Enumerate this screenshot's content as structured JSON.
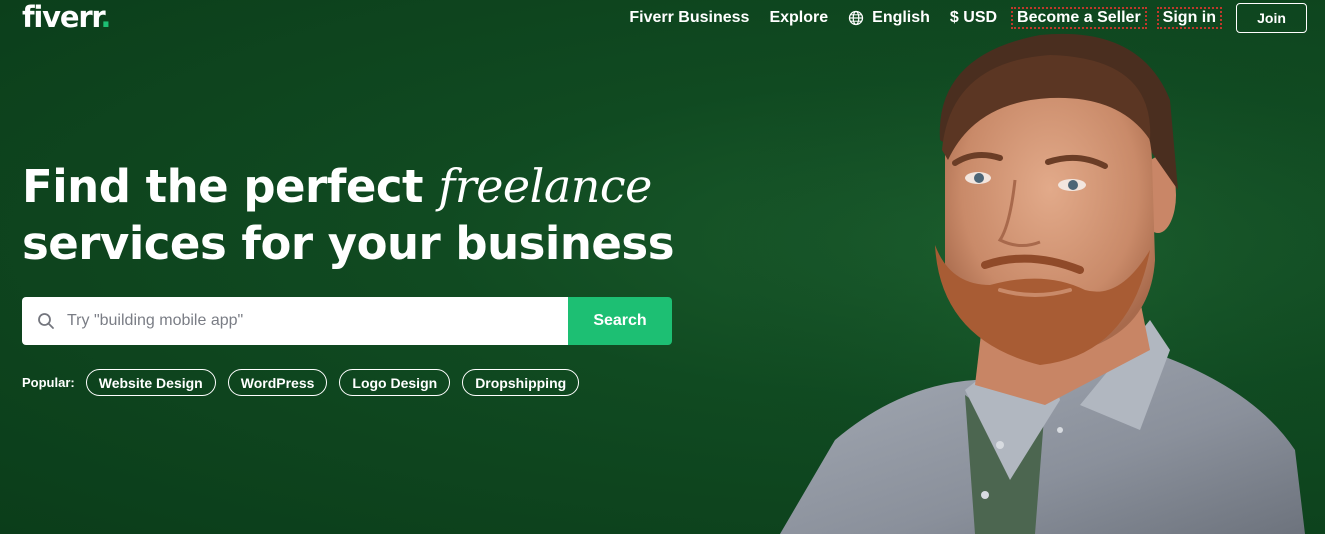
{
  "header": {
    "logo_text": "fiverr",
    "logo_dot": ".",
    "nav": {
      "business": "Fiverr Business",
      "explore": "Explore",
      "language": "English",
      "currency": "$ USD",
      "become_seller": "Become a Seller",
      "sign_in": "Sign in",
      "join": "Join"
    },
    "icons": {
      "language": "globe-icon"
    }
  },
  "hero": {
    "headline_part1": "Find the perfect ",
    "headline_accent": "freelance",
    "headline_part2": "services for your business"
  },
  "search": {
    "placeholder": "Try \"building mobile app\"",
    "value": "",
    "button_label": "Search",
    "icon": "search-icon"
  },
  "popular": {
    "label": "Popular:",
    "tags": [
      "Website Design",
      "WordPress",
      "Logo Design",
      "Dropshipping"
    ]
  },
  "colors": {
    "background": "#0d4020",
    "accent": "#1dbf73",
    "text": "#ffffff"
  }
}
